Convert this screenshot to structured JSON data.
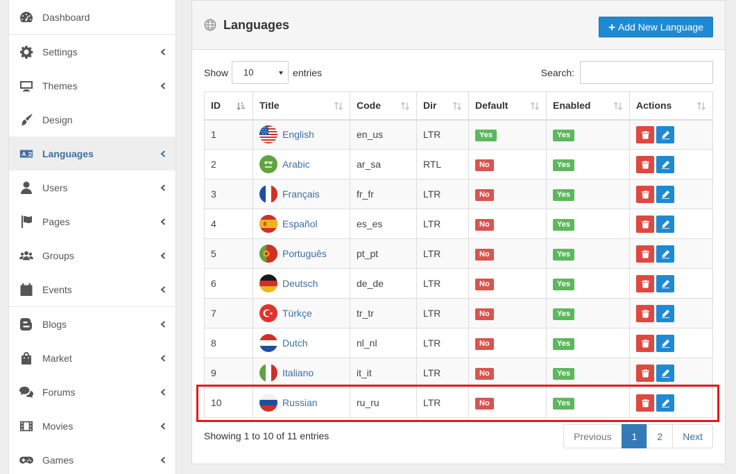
{
  "sidebar": {
    "groups": [
      [
        {
          "label": "Dashboard",
          "icon": "dashboard-icon"
        }
      ],
      [
        {
          "label": "Settings",
          "icon": "gear-icon",
          "expandable": true
        },
        {
          "label": "Themes",
          "icon": "monitor-icon",
          "expandable": true
        },
        {
          "label": "Design",
          "icon": "paint-brush-icon"
        },
        {
          "label": "Languages",
          "icon": "language-icon",
          "expandable": true,
          "active": true
        },
        {
          "label": "Users",
          "icon": "user-icon",
          "expandable": true
        },
        {
          "label": "Pages",
          "icon": "flag-icon",
          "expandable": true
        },
        {
          "label": "Groups",
          "icon": "users-icon",
          "expandable": true
        },
        {
          "label": "Events",
          "icon": "calendar-icon",
          "expandable": true
        }
      ],
      [
        {
          "label": "Blogs",
          "icon": "blogger-icon",
          "expandable": true
        },
        {
          "label": "Market",
          "icon": "shopping-bag-icon",
          "expandable": true
        },
        {
          "label": "Forums",
          "icon": "comments-icon",
          "expandable": true
        },
        {
          "label": "Movies",
          "icon": "film-icon",
          "expandable": true
        },
        {
          "label": "Games",
          "icon": "gamepad-icon",
          "expandable": true
        }
      ]
    ]
  },
  "panel": {
    "title": "Languages",
    "add_button": "Add New Language",
    "show_label": "Show",
    "entries_label": "entries",
    "page_size": "10",
    "search_label": "Search:",
    "search_value": ""
  },
  "table": {
    "columns": [
      "ID",
      "Title",
      "Code",
      "Dir",
      "Default",
      "Enabled",
      "Actions"
    ],
    "rows": [
      {
        "id": "1",
        "title": "English",
        "flag": "us",
        "code": "en_us",
        "dir": "LTR",
        "default": "Yes",
        "enabled": "Yes"
      },
      {
        "id": "2",
        "title": "Arabic",
        "flag": "sa",
        "code": "ar_sa",
        "dir": "RTL",
        "default": "No",
        "enabled": "Yes"
      },
      {
        "id": "3",
        "title": "Français",
        "flag": "fr",
        "code": "fr_fr",
        "dir": "LTR",
        "default": "No",
        "enabled": "Yes"
      },
      {
        "id": "4",
        "title": "Español",
        "flag": "es",
        "code": "es_es",
        "dir": "LTR",
        "default": "No",
        "enabled": "Yes"
      },
      {
        "id": "5",
        "title": "Português",
        "flag": "pt",
        "code": "pt_pt",
        "dir": "LTR",
        "default": "No",
        "enabled": "Yes"
      },
      {
        "id": "6",
        "title": "Deutsch",
        "flag": "de",
        "code": "de_de",
        "dir": "LTR",
        "default": "No",
        "enabled": "Yes"
      },
      {
        "id": "7",
        "title": "Türkçe",
        "flag": "tr",
        "code": "tr_tr",
        "dir": "LTR",
        "default": "No",
        "enabled": "Yes"
      },
      {
        "id": "8",
        "title": "Dutch",
        "flag": "nl",
        "code": "nl_nl",
        "dir": "LTR",
        "default": "No",
        "enabled": "Yes"
      },
      {
        "id": "9",
        "title": "Italiano",
        "flag": "it",
        "code": "it_it",
        "dir": "LTR",
        "default": "No",
        "enabled": "Yes"
      },
      {
        "id": "10",
        "title": "Russian",
        "flag": "ru",
        "code": "ru_ru",
        "dir": "LTR",
        "default": "No",
        "enabled": "Yes"
      }
    ]
  },
  "footer": {
    "info": "Showing 1 to 10 of 11 entries",
    "pagination": [
      "Previous",
      "1",
      "2",
      "Next"
    ],
    "current_page": "1"
  },
  "colors": {
    "accent": "#1f8ad2",
    "active_link": "#3c6fa5",
    "yes_badge": "#5cb85c",
    "no_badge": "#d9534f",
    "highlight": "#e8161b"
  }
}
